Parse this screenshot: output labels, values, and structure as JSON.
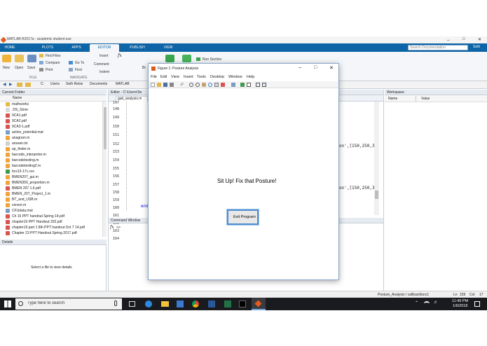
{
  "matlab": {
    "title": "MATLAB R2017a - academic student use",
    "tabs": [
      "HOME",
      "PLOTS",
      "APPS",
      "EDITOR",
      "PUBLISH",
      "VIEW"
    ],
    "ribbon": {
      "new": "New",
      "open": "Open",
      "save": "Save",
      "find_files": "Find Files",
      "compare": "Compare",
      "print": "Print",
      "go_to": "Go To",
      "find": "Find",
      "insert": "Insert",
      "comment": "Comment",
      "indent": "Indent",
      "breakpoints": "Br",
      "run_section": "Run Section",
      "navigate": "NAVIGATE",
      "file_group": "FILE"
    },
    "search_placeholder": "Search Documentation",
    "user": "Seth",
    "address": [
      "C:",
      "Users",
      "Seth Reise",
      "Documents",
      "MATLAB"
    ]
  },
  "current_folder": {
    "title": "Current Folder",
    "column": "Name",
    "files": [
      "mathworks",
      ".DS_Store",
      "9CA1.pdf",
      "9CA2.pdf",
      "9CA3-1.pdf",
      "action_potential.mat",
      "anagram.m",
      "answer.txt",
      "ap_finder.m",
      "barcode_interpreter.m",
      "barcodetesting.m",
      "barcodetesting2.m",
      "bcs13-17c.csv",
      "BMEN207_gui.m",
      "BMEN350_proportion.m",
      "BMEN 207 1.6.pdf",
      "BMEN_207_Project_1.m",
      "BT_and_USB.m",
      "censor.m",
      "CFUdata.mat",
      "Ch 15 PPT handout Spring 14.pdf",
      "chapter16 PPT Handout 202.pdf",
      "chapter19 part 1 8th PPT handout Oct 7 14.pdf",
      "Chapter 23 PPT Handout Spring 2017.pdf"
    ]
  },
  "details": {
    "title": "Details",
    "message": "Select a file to view details"
  },
  "editor": {
    "title": "Editor - C:\\Users\\Se",
    "tab": "gait_analysis.m",
    "line_numbers": [
      "147",
      "148",
      "149",
      "150",
      "151",
      "152",
      "153",
      "154",
      "155",
      "156",
      "157",
      "158",
      "159",
      "160",
      "161",
      "162",
      "163",
      "164"
    ],
    "code_fragment_1": "on',[150,250,3",
    "code_fragment_2": "on',[150,250,3",
    "code_end": "end"
  },
  "command_window": {
    "title": "Command Window",
    "prompt": ">>",
    "fx": "fx"
  },
  "workspace": {
    "title": "Workspace",
    "col_name": "Name",
    "col_value": "Value"
  },
  "status": {
    "function": "Posture_Analysis / callbackfunc1",
    "ln": "Ln",
    "ln_val": "159",
    "col": "Col",
    "col_val": "17"
  },
  "figure": {
    "title": "Figure 1: Posture Analysis",
    "menu": [
      "File",
      "Edit",
      "View",
      "Insert",
      "Tools",
      "Desktop",
      "Window",
      "Help"
    ],
    "message": "Sit Up! Fix that Posture!",
    "button": "Exit Program"
  },
  "taskbar": {
    "search_placeholder": "Type here to search",
    "time": "11:49 PM",
    "date": "1/6/2018"
  },
  "colors": {
    "ribbon_blue": "#0d64a6",
    "taskbar": "#1a1b1f",
    "figure_border": "#8aa6c8"
  }
}
